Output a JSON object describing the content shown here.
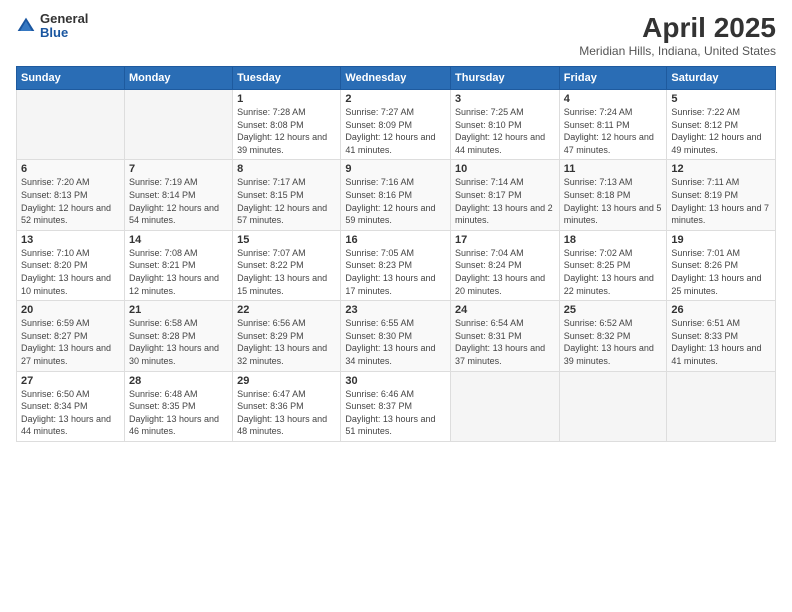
{
  "logo": {
    "general": "General",
    "blue": "Blue"
  },
  "title": "April 2025",
  "location": "Meridian Hills, Indiana, United States",
  "weekdays": [
    "Sunday",
    "Monday",
    "Tuesday",
    "Wednesday",
    "Thursday",
    "Friday",
    "Saturday"
  ],
  "weeks": [
    [
      {
        "day": "",
        "sunrise": "",
        "sunset": "",
        "daylight": ""
      },
      {
        "day": "",
        "sunrise": "",
        "sunset": "",
        "daylight": ""
      },
      {
        "day": "1",
        "sunrise": "Sunrise: 7:28 AM",
        "sunset": "Sunset: 8:08 PM",
        "daylight": "Daylight: 12 hours and 39 minutes."
      },
      {
        "day": "2",
        "sunrise": "Sunrise: 7:27 AM",
        "sunset": "Sunset: 8:09 PM",
        "daylight": "Daylight: 12 hours and 41 minutes."
      },
      {
        "day": "3",
        "sunrise": "Sunrise: 7:25 AM",
        "sunset": "Sunset: 8:10 PM",
        "daylight": "Daylight: 12 hours and 44 minutes."
      },
      {
        "day": "4",
        "sunrise": "Sunrise: 7:24 AM",
        "sunset": "Sunset: 8:11 PM",
        "daylight": "Daylight: 12 hours and 47 minutes."
      },
      {
        "day": "5",
        "sunrise": "Sunrise: 7:22 AM",
        "sunset": "Sunset: 8:12 PM",
        "daylight": "Daylight: 12 hours and 49 minutes."
      }
    ],
    [
      {
        "day": "6",
        "sunrise": "Sunrise: 7:20 AM",
        "sunset": "Sunset: 8:13 PM",
        "daylight": "Daylight: 12 hours and 52 minutes."
      },
      {
        "day": "7",
        "sunrise": "Sunrise: 7:19 AM",
        "sunset": "Sunset: 8:14 PM",
        "daylight": "Daylight: 12 hours and 54 minutes."
      },
      {
        "day": "8",
        "sunrise": "Sunrise: 7:17 AM",
        "sunset": "Sunset: 8:15 PM",
        "daylight": "Daylight: 12 hours and 57 minutes."
      },
      {
        "day": "9",
        "sunrise": "Sunrise: 7:16 AM",
        "sunset": "Sunset: 8:16 PM",
        "daylight": "Daylight: 12 hours and 59 minutes."
      },
      {
        "day": "10",
        "sunrise": "Sunrise: 7:14 AM",
        "sunset": "Sunset: 8:17 PM",
        "daylight": "Daylight: 13 hours and 2 minutes."
      },
      {
        "day": "11",
        "sunrise": "Sunrise: 7:13 AM",
        "sunset": "Sunset: 8:18 PM",
        "daylight": "Daylight: 13 hours and 5 minutes."
      },
      {
        "day": "12",
        "sunrise": "Sunrise: 7:11 AM",
        "sunset": "Sunset: 8:19 PM",
        "daylight": "Daylight: 13 hours and 7 minutes."
      }
    ],
    [
      {
        "day": "13",
        "sunrise": "Sunrise: 7:10 AM",
        "sunset": "Sunset: 8:20 PM",
        "daylight": "Daylight: 13 hours and 10 minutes."
      },
      {
        "day": "14",
        "sunrise": "Sunrise: 7:08 AM",
        "sunset": "Sunset: 8:21 PM",
        "daylight": "Daylight: 13 hours and 12 minutes."
      },
      {
        "day": "15",
        "sunrise": "Sunrise: 7:07 AM",
        "sunset": "Sunset: 8:22 PM",
        "daylight": "Daylight: 13 hours and 15 minutes."
      },
      {
        "day": "16",
        "sunrise": "Sunrise: 7:05 AM",
        "sunset": "Sunset: 8:23 PM",
        "daylight": "Daylight: 13 hours and 17 minutes."
      },
      {
        "day": "17",
        "sunrise": "Sunrise: 7:04 AM",
        "sunset": "Sunset: 8:24 PM",
        "daylight": "Daylight: 13 hours and 20 minutes."
      },
      {
        "day": "18",
        "sunrise": "Sunrise: 7:02 AM",
        "sunset": "Sunset: 8:25 PM",
        "daylight": "Daylight: 13 hours and 22 minutes."
      },
      {
        "day": "19",
        "sunrise": "Sunrise: 7:01 AM",
        "sunset": "Sunset: 8:26 PM",
        "daylight": "Daylight: 13 hours and 25 minutes."
      }
    ],
    [
      {
        "day": "20",
        "sunrise": "Sunrise: 6:59 AM",
        "sunset": "Sunset: 8:27 PM",
        "daylight": "Daylight: 13 hours and 27 minutes."
      },
      {
        "day": "21",
        "sunrise": "Sunrise: 6:58 AM",
        "sunset": "Sunset: 8:28 PM",
        "daylight": "Daylight: 13 hours and 30 minutes."
      },
      {
        "day": "22",
        "sunrise": "Sunrise: 6:56 AM",
        "sunset": "Sunset: 8:29 PM",
        "daylight": "Daylight: 13 hours and 32 minutes."
      },
      {
        "day": "23",
        "sunrise": "Sunrise: 6:55 AM",
        "sunset": "Sunset: 8:30 PM",
        "daylight": "Daylight: 13 hours and 34 minutes."
      },
      {
        "day": "24",
        "sunrise": "Sunrise: 6:54 AM",
        "sunset": "Sunset: 8:31 PM",
        "daylight": "Daylight: 13 hours and 37 minutes."
      },
      {
        "day": "25",
        "sunrise": "Sunrise: 6:52 AM",
        "sunset": "Sunset: 8:32 PM",
        "daylight": "Daylight: 13 hours and 39 minutes."
      },
      {
        "day": "26",
        "sunrise": "Sunrise: 6:51 AM",
        "sunset": "Sunset: 8:33 PM",
        "daylight": "Daylight: 13 hours and 41 minutes."
      }
    ],
    [
      {
        "day": "27",
        "sunrise": "Sunrise: 6:50 AM",
        "sunset": "Sunset: 8:34 PM",
        "daylight": "Daylight: 13 hours and 44 minutes."
      },
      {
        "day": "28",
        "sunrise": "Sunrise: 6:48 AM",
        "sunset": "Sunset: 8:35 PM",
        "daylight": "Daylight: 13 hours and 46 minutes."
      },
      {
        "day": "29",
        "sunrise": "Sunrise: 6:47 AM",
        "sunset": "Sunset: 8:36 PM",
        "daylight": "Daylight: 13 hours and 48 minutes."
      },
      {
        "day": "30",
        "sunrise": "Sunrise: 6:46 AM",
        "sunset": "Sunset: 8:37 PM",
        "daylight": "Daylight: 13 hours and 51 minutes."
      },
      {
        "day": "",
        "sunrise": "",
        "sunset": "",
        "daylight": ""
      },
      {
        "day": "",
        "sunrise": "",
        "sunset": "",
        "daylight": ""
      },
      {
        "day": "",
        "sunrise": "",
        "sunset": "",
        "daylight": ""
      }
    ]
  ]
}
